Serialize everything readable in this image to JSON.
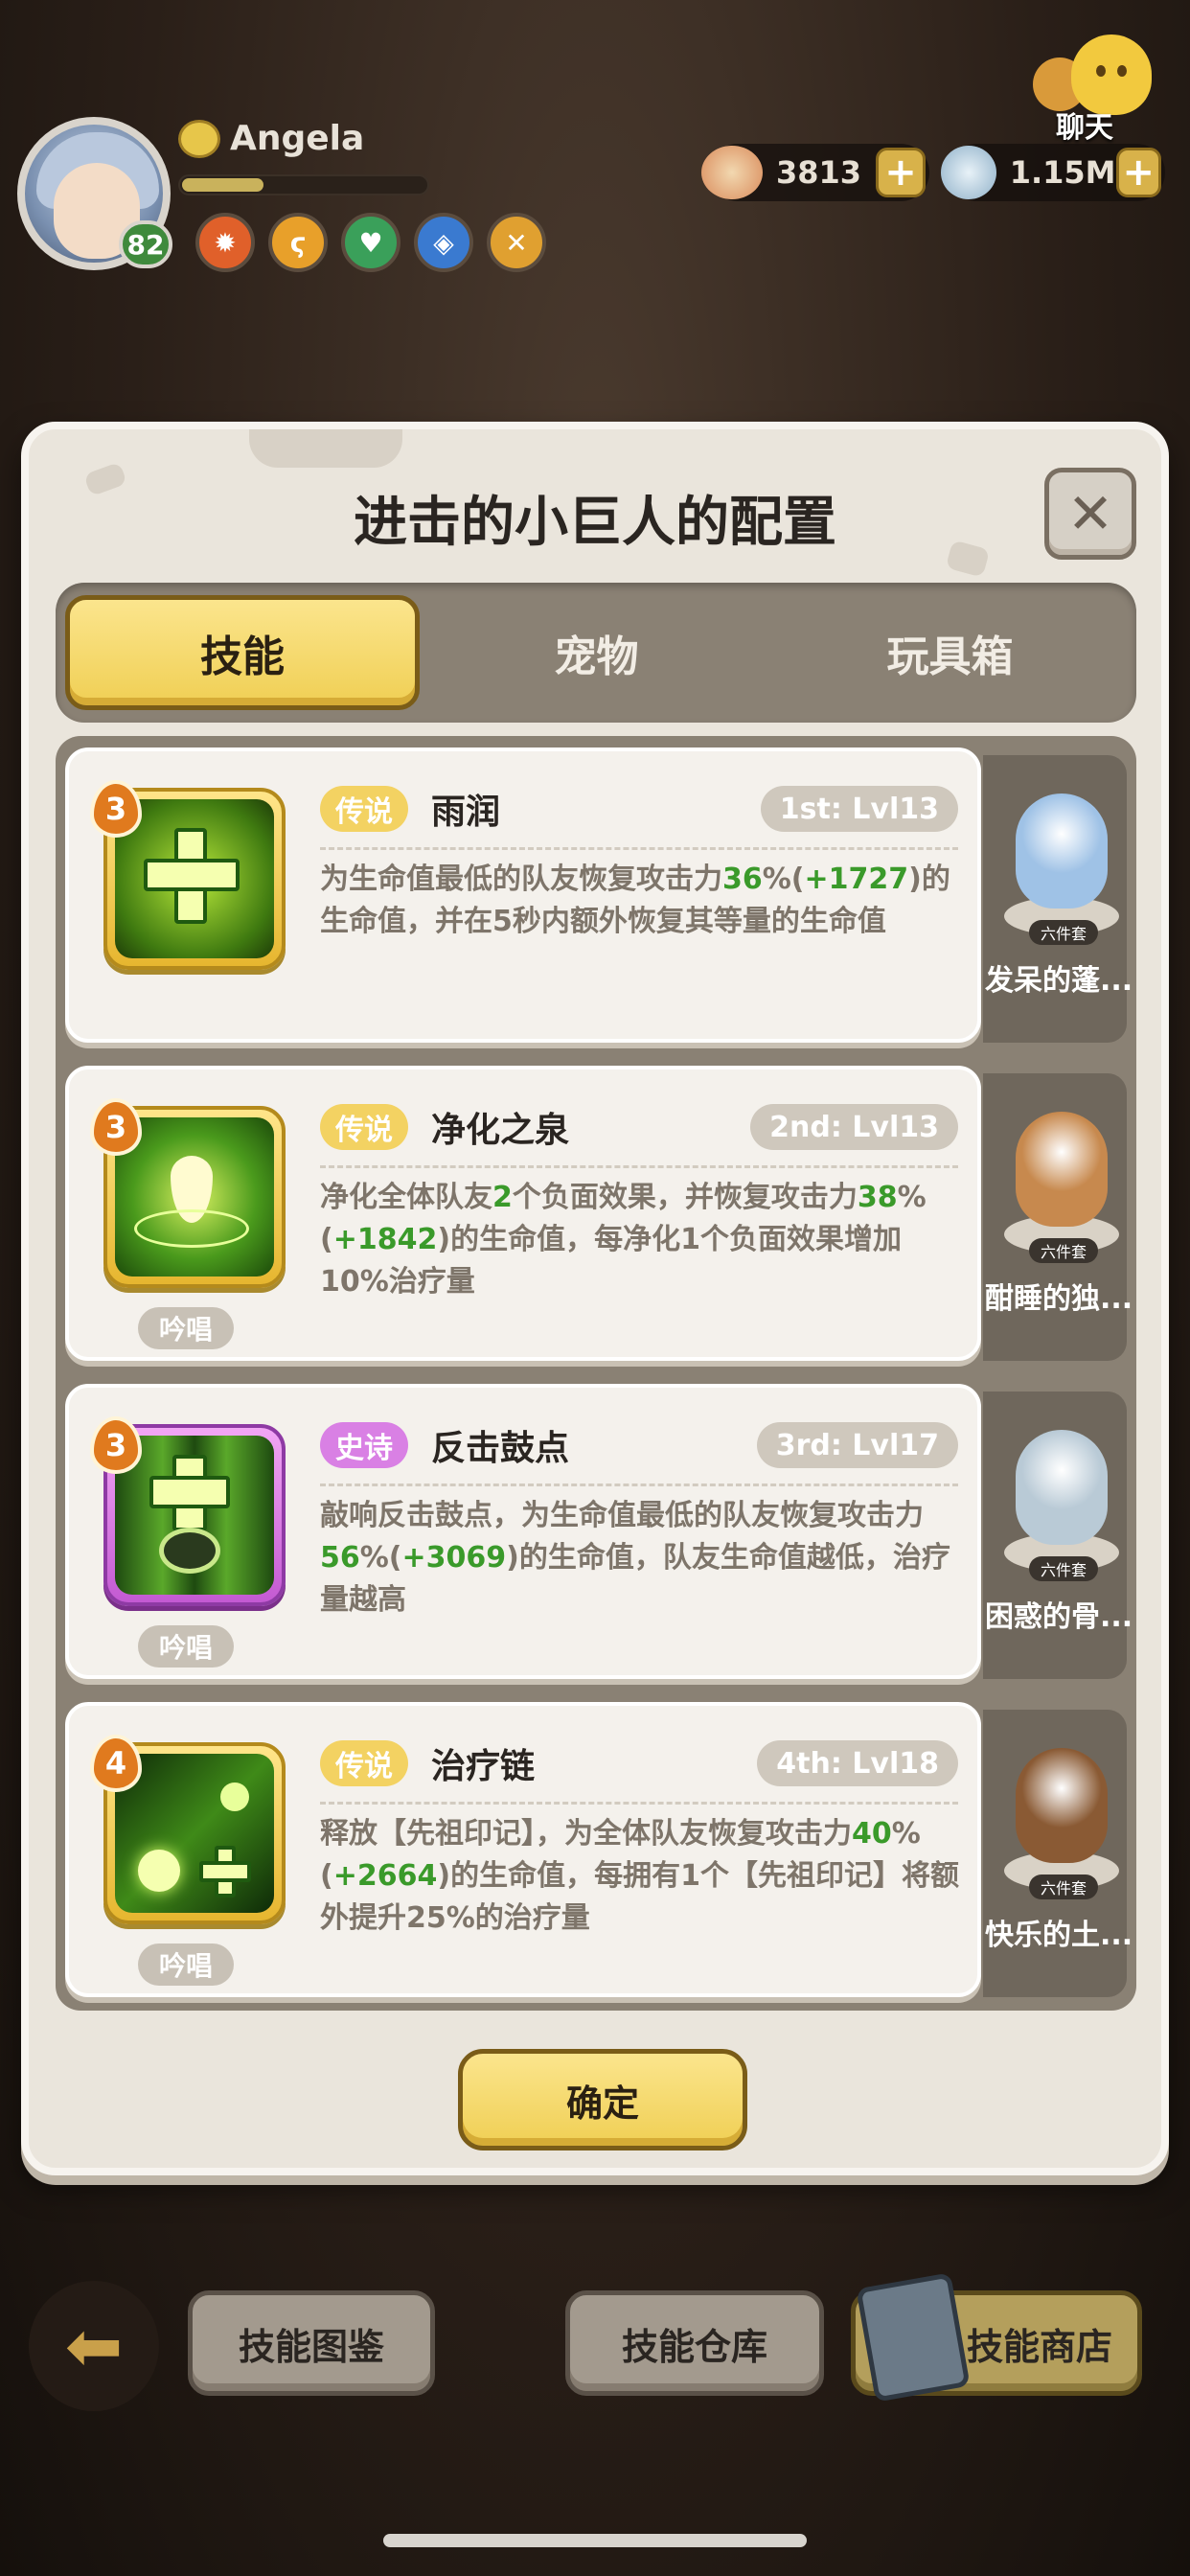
{
  "player": {
    "name": "Angela",
    "level": "82",
    "xp_fraction": 0.33
  },
  "currencies": [
    {
      "icon": "shell-coin-icon",
      "value": "3813"
    },
    {
      "icon": "pearl-icon",
      "value": "1.15M"
    }
  ],
  "chat": {
    "label": "聊天"
  },
  "modal": {
    "title": "进击的小巨人的配置",
    "tabs": [
      {
        "label": "技能",
        "active": true
      },
      {
        "label": "宠物",
        "active": false
      },
      {
        "label": "玩具箱",
        "active": false
      }
    ],
    "skills": [
      {
        "tier": "3",
        "rarity": "传说",
        "rarity_type": "legend",
        "name": "雨润",
        "slot": "1st: Lvl13",
        "desc_parts": [
          {
            "t": "为生命值最低的队友恢复攻击力"
          },
          {
            "t": "36",
            "g": true
          },
          {
            "t": "%("
          },
          {
            "t": "+1727",
            "g": true
          },
          {
            "t": ")的生命值，并在5秒内额外恢复其等量的生命值"
          }
        ],
        "chant": null,
        "pet": {
          "name": "发呆的蓬...",
          "set": "六件套",
          "color": "#9fc2e6"
        }
      },
      {
        "tier": "3",
        "rarity": "传说",
        "rarity_type": "legend",
        "name": "净化之泉",
        "slot": "2nd: Lvl13",
        "desc_parts": [
          {
            "t": "净化全体队友"
          },
          {
            "t": "2",
            "g": true
          },
          {
            "t": "个负面效果，并恢复攻击力"
          },
          {
            "t": "38",
            "g": true
          },
          {
            "t": "%("
          },
          {
            "t": "+1842",
            "g": true
          },
          {
            "t": ")的生命值，每净化1个负面效果增加10%治疗量"
          }
        ],
        "chant": "吟唱",
        "pet": {
          "name": "酣睡的独...",
          "set": "六件套",
          "color": "#c7894e"
        }
      },
      {
        "tier": "3",
        "rarity": "史诗",
        "rarity_type": "epic",
        "name": "反击鼓点",
        "slot": "3rd: Lvl17",
        "desc_parts": [
          {
            "t": "敲响反击鼓点，为生命值最低的队友恢复攻击力"
          },
          {
            "t": "56",
            "g": true
          },
          {
            "t": "%("
          },
          {
            "t": "+3069",
            "g": true
          },
          {
            "t": ")的生命值，队友生命值越低，治疗量越高"
          }
        ],
        "chant": "吟唱",
        "pet": {
          "name": "困惑的骨...",
          "set": "六件套",
          "color": "#b9cad6"
        }
      },
      {
        "tier": "4",
        "rarity": "传说",
        "rarity_type": "legend",
        "name": "治疗链",
        "slot": "4th: Lvl18",
        "desc_parts": [
          {
            "t": "释放【先祖印记】，为全体队友恢复攻击力"
          },
          {
            "t": "40",
            "g": true
          },
          {
            "t": "%("
          },
          {
            "t": "+2664",
            "g": true
          },
          {
            "t": ")的生命值，每拥有1个【先祖印记】将额外提升25%的治疗量"
          }
        ],
        "chant": "吟唱",
        "pet": {
          "name": "快乐的土...",
          "set": "六件套",
          "color": "#8a5a34"
        }
      }
    ],
    "confirm_label": "确定"
  },
  "bottom": {
    "skill_catalog": "技能图鉴",
    "skill_storage": "技能仓库",
    "skill_shop": "技能商店"
  }
}
